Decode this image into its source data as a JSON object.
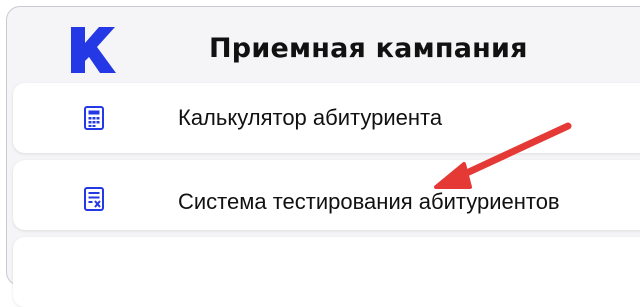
{
  "header": {
    "title": "Приемная кампания",
    "logo_icon": "k-logo-icon"
  },
  "menu": {
    "items": [
      {
        "label": "Калькулятор абитуриента",
        "icon": "calculator-icon"
      },
      {
        "label": "Система тестирования абитуриентов",
        "icon": "test-checklist-icon"
      },
      {
        "label": "",
        "icon": ""
      }
    ]
  },
  "colors": {
    "brand_blue": "#2438e6",
    "arrow_red": "#e53935",
    "panel_bg": "#f5f5f7",
    "item_bg": "#ffffff"
  }
}
